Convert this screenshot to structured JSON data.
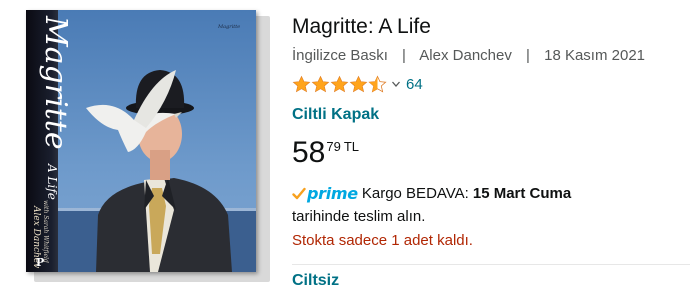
{
  "product": {
    "title": "Magritte: A Life",
    "edition": "İngilizce Baskı",
    "author": "Alex Danchev",
    "date": "18 Kasım 2021",
    "rating_value": 4.5,
    "rating_count": "64",
    "format": "Ciltli Kapak",
    "price_whole": "58",
    "price_fraction": "79",
    "price_currency": "TL",
    "prime_label": "prime",
    "shipping_text": "Kargo BEDAVA:",
    "shipping_date": "15 Mart Cuma",
    "delivery_text": "tarihinde teslim alın.",
    "stock_text": "Stokta sadece 1 adet kaldı.",
    "alt_format": "Ciltsiz",
    "separator": "|"
  },
  "cover": {
    "spine_title": "Magritte",
    "spine_subtitle": "A Life",
    "spine_author": "Alex Danchev",
    "spine_coauthor": "with Sarah Whitfield",
    "publisher_mark": "P",
    "signature": "Magritte"
  },
  "colors": {
    "link": "#007185",
    "price_red": "#b12704",
    "star": "#ffa41c",
    "prime_blue": "#00a8e1",
    "prime_check": "#f7a11f"
  },
  "icons": {
    "star": "star-icon",
    "chevron": "chevron-down-icon",
    "prime_check": "check-icon"
  }
}
